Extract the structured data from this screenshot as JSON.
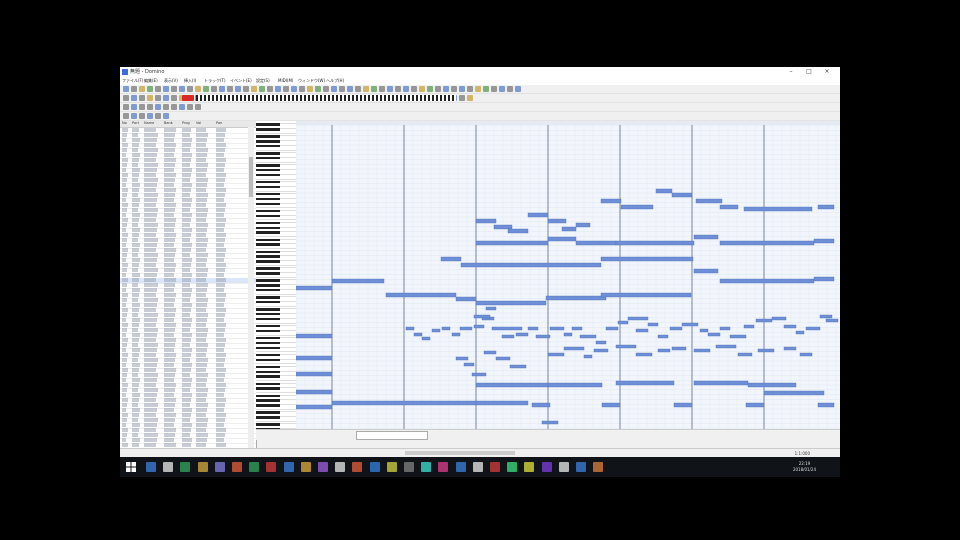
{
  "window": {
    "title": "無題 - Domino"
  },
  "menu": {
    "items": [
      "ファイル(F)",
      "編集(E)",
      "表示(V)",
      "挿入(I)",
      "トラック(T)",
      "イベント(E)",
      "設定(S)",
      "MIDI(M)",
      "ウィンドウ(W)",
      "ヘルプ(H)"
    ]
  },
  "track_list": {
    "columns": [
      "No",
      "Port",
      "Name",
      "Bank",
      "Prog",
      "Vol",
      "Pan"
    ]
  },
  "status": {
    "position": "1:1:000"
  },
  "taskbar": {
    "clock_time": "22:19",
    "clock_date": "2018/01/24"
  },
  "colors": {
    "note": "#6e8fd6",
    "note_border": "#4e6fb8",
    "grid_bg": "#f2f6fc",
    "measure_line": "#5a6a84",
    "play_button": "#d92a2a"
  }
}
